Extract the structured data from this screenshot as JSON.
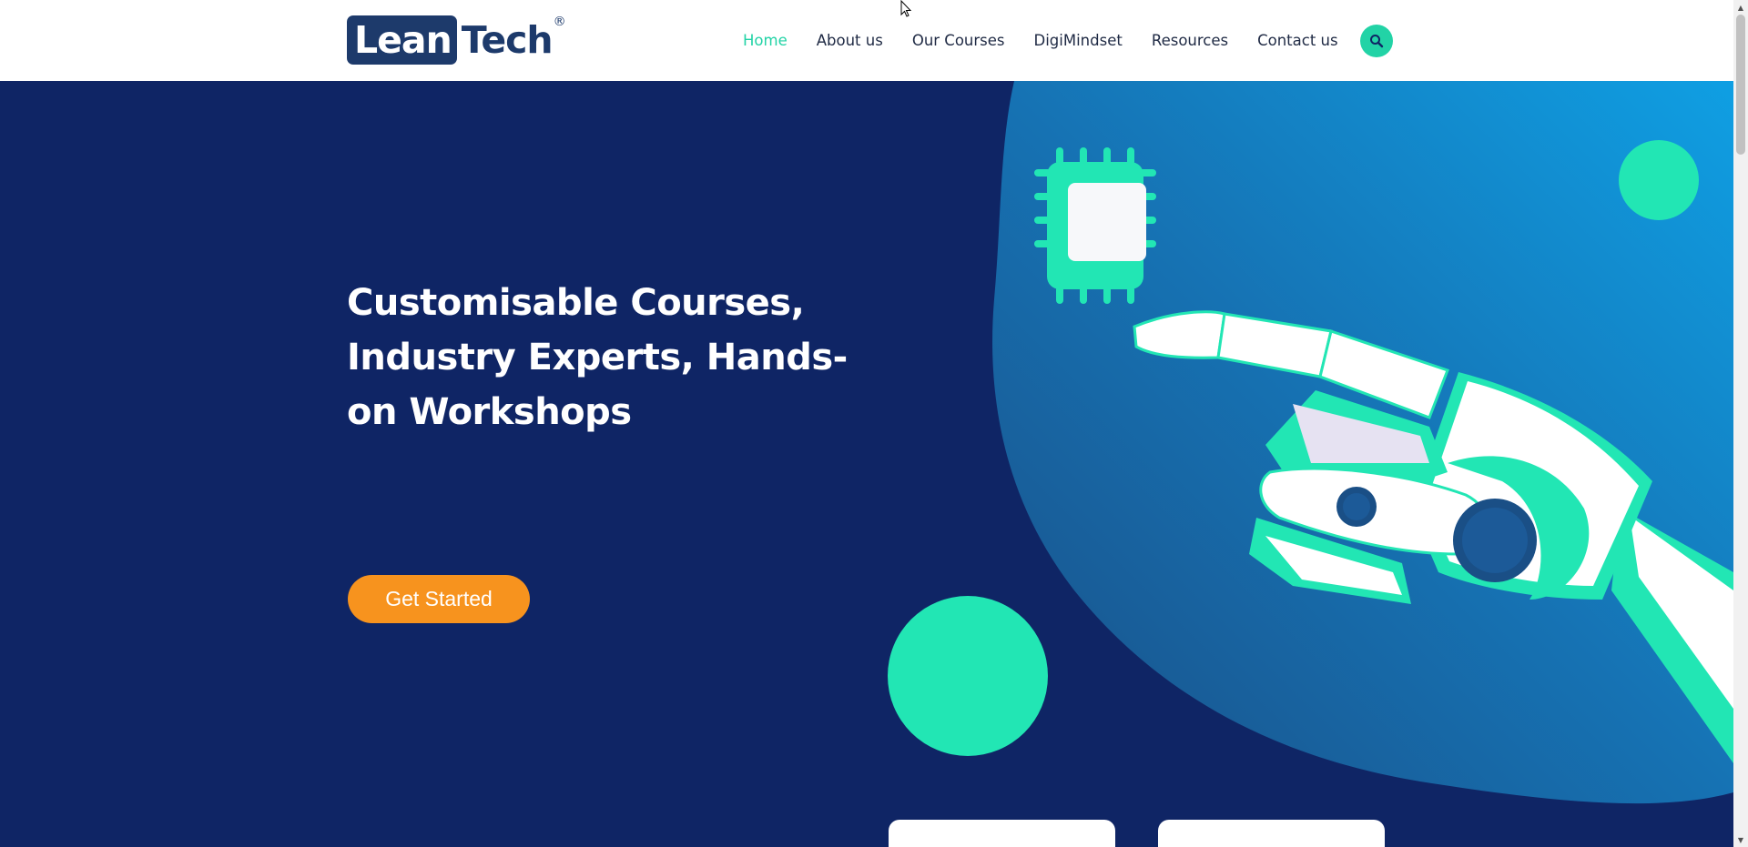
{
  "header": {
    "logo": {
      "part1": "Lean",
      "part2": "Tech",
      "reg": "®"
    },
    "nav": [
      {
        "label": "Home",
        "active": true
      },
      {
        "label": "About us",
        "active": false
      },
      {
        "label": "Our Courses",
        "active": false
      },
      {
        "label": "DigiMindset",
        "active": false
      },
      {
        "label": "Resources",
        "active": false
      },
      {
        "label": "Contact us",
        "active": false
      }
    ],
    "search_icon": "search-icon"
  },
  "hero": {
    "title": "Customisable Courses, Industry Experts, Hands-on Workshops",
    "cta_label": "Get Started",
    "illustration": "robot-hand-pointing-at-chip"
  },
  "colors": {
    "navy": "#0f2565",
    "accent": "#22d3a6",
    "cta": "#f7931e",
    "logo": "#1d3a6b"
  }
}
